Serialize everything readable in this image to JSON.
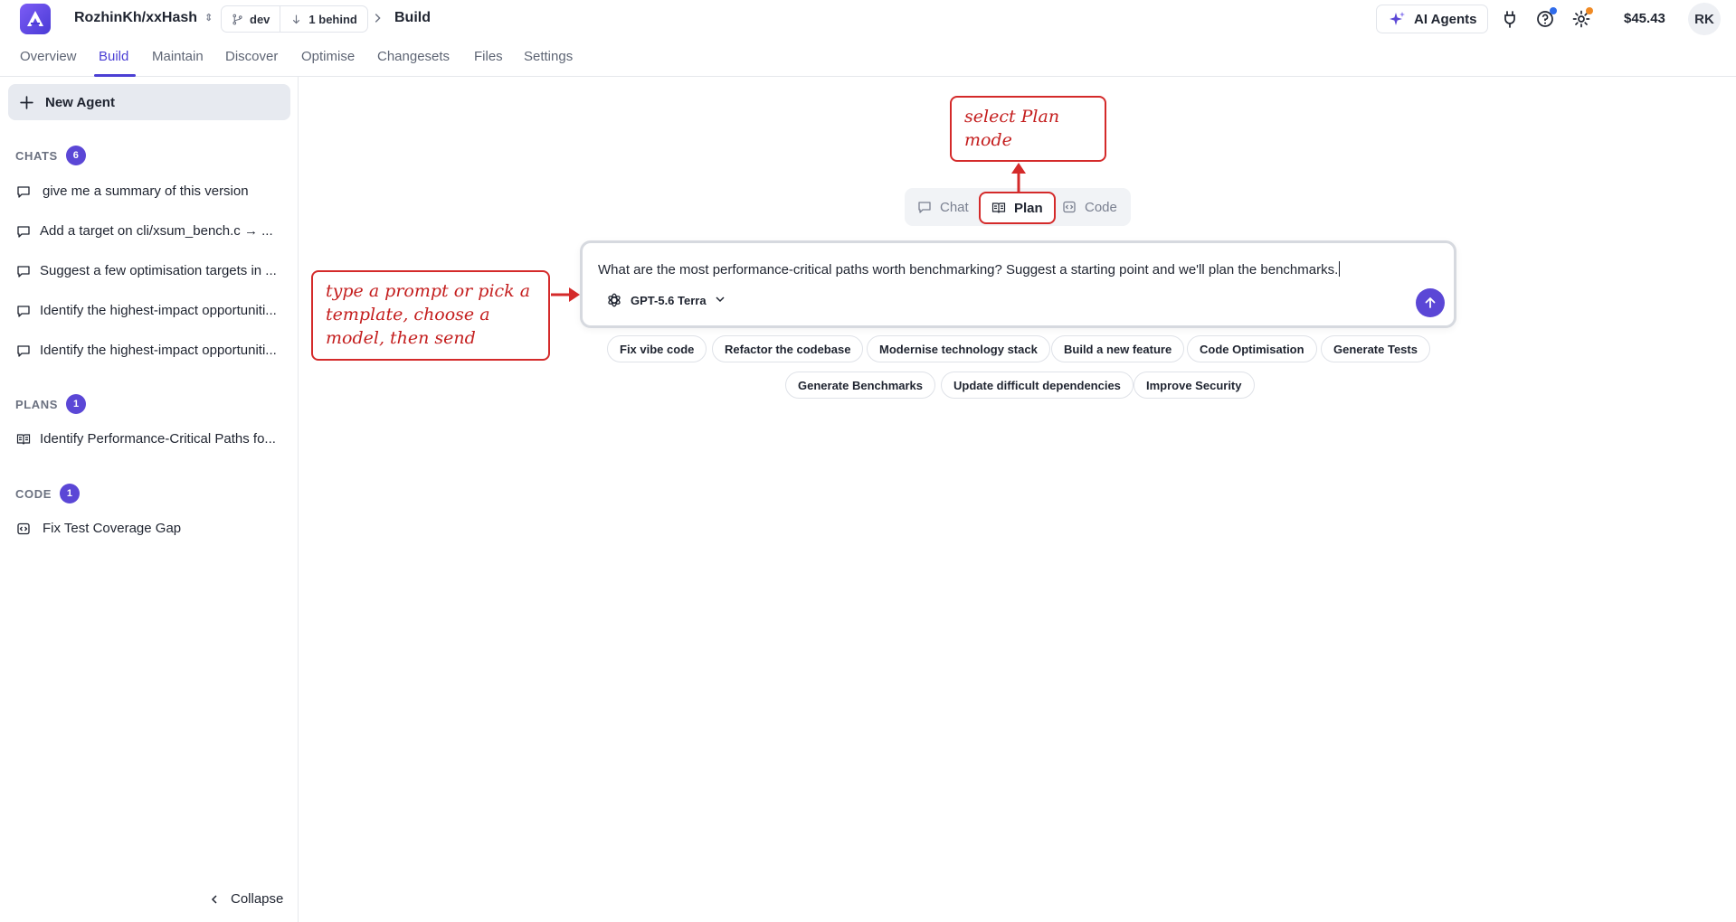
{
  "header": {
    "repo_name": "RozhinKh/xxHash",
    "branch": "dev",
    "behind": "1 behind",
    "breadcrumb_current": "Build",
    "ai_agents_label": "AI Agents",
    "balance": "$45.43",
    "avatar_initials": "RK",
    "colors": {
      "brand": "#5b47d6",
      "notification_dot_blue": "#2f6bea",
      "notification_dot_orange": "#f08a24"
    }
  },
  "nav": {
    "tabs": [
      {
        "label": "Overview"
      },
      {
        "label": "Build",
        "active": true
      },
      {
        "label": "Maintain"
      },
      {
        "label": "Discover"
      },
      {
        "label": "Optimise"
      },
      {
        "label": "Changesets"
      },
      {
        "label": "Files"
      },
      {
        "label": "Settings"
      }
    ]
  },
  "sidebar": {
    "new_agent_label": "New Agent",
    "chats": {
      "title": "CHATS",
      "count": "6",
      "items": [
        "give me a summary of this version",
        "Add a target on cli/xsum_bench.c → ...",
        "Suggest a few optimisation targets in ...",
        "Identify the highest-impact opportuniti...",
        "Identify the highest-impact opportuniti..."
      ]
    },
    "plans": {
      "title": "PLANS",
      "count": "1",
      "items": [
        "Identify Performance-Critical Paths fo..."
      ]
    },
    "code": {
      "title": "CODE",
      "count": "1",
      "items": [
        "Fix Test Coverage Gap"
      ]
    },
    "collapse_label": "Collapse"
  },
  "main": {
    "modes": [
      {
        "label": "Chat",
        "icon": "chat-bubble-icon"
      },
      {
        "label": "Plan",
        "icon": "book-icon",
        "active": true
      },
      {
        "label": "Code",
        "icon": "code-icon"
      }
    ],
    "prompt_text": "What are the most performance-critical paths worth benchmarking? Suggest a starting point and we'll plan the benchmarks.",
    "model_name": "GPT-5.6 Terra",
    "templates_row1": [
      "Fix vibe code",
      "Refactor the codebase",
      "Modernise technology stack",
      "Build a new feature",
      "Code Optimisation",
      "Generate Tests"
    ],
    "templates_row2": [
      "Generate Benchmarks",
      "Update difficult dependencies",
      "Improve Security"
    ]
  },
  "annotations": {
    "plan_note": "select Plan mode",
    "prompt_note": "type a prompt or pick a template, choose a model, then send",
    "color": "#d42a2a"
  }
}
